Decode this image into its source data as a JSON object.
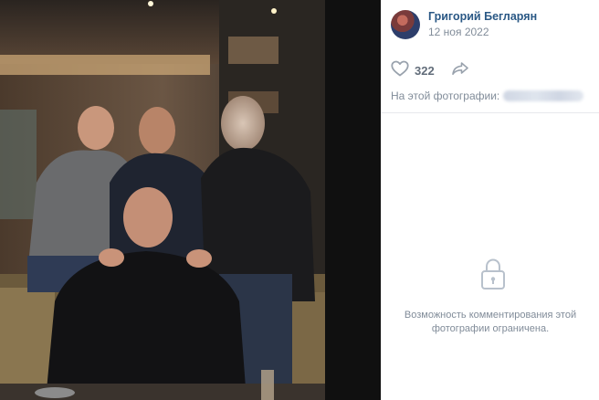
{
  "post": {
    "author_name": "Григорий Бегларян",
    "date": "12 ноя 2022",
    "likes": "322",
    "tags_label": "На этой фотографии:",
    "comments_restricted_line1": "Возможность комментирования этой",
    "comments_restricted_line2": "фотографии ограничена."
  },
  "icons": {
    "like": "heart-icon",
    "share": "share-arrow-icon",
    "lock": "lock-icon"
  },
  "colors": {
    "author_link": "#2a5885",
    "muted_text": "#818c99",
    "icon_gray": "#99a2ad",
    "divider": "#e7e8ec"
  }
}
